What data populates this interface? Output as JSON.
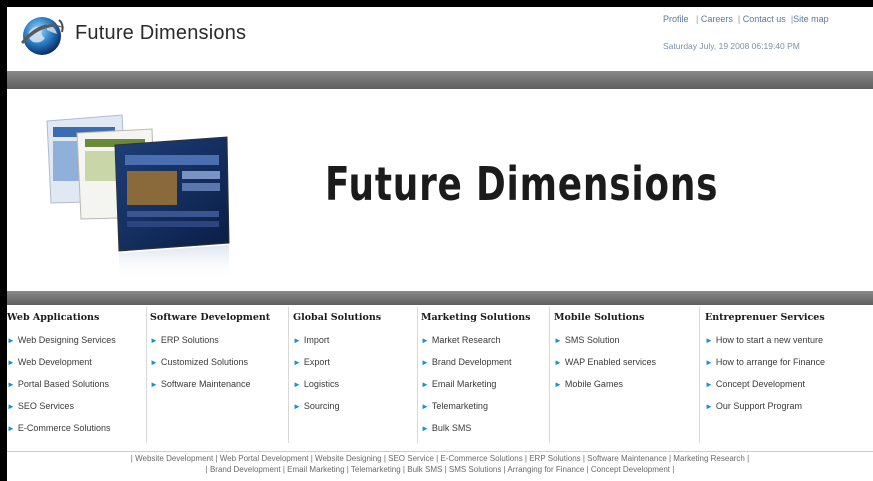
{
  "header": {
    "brand": "Future Dimensions",
    "links": [
      "Profile",
      "Careers",
      "Contact us",
      "Site map"
    ],
    "datetime": "Saturday July, 19 2008 06:19:40 PM"
  },
  "banner": {
    "title": "Future Dimensions"
  },
  "menus": [
    {
      "heading": "Web Applications",
      "items": [
        "Web Designing Services",
        "Web Development",
        "Portal Based Solutions",
        "SEO Services",
        "E-Commerce Solutions"
      ]
    },
    {
      "heading": "Software Development",
      "items": [
        "ERP Solutions",
        "Customized Solutions",
        "Software Maintenance"
      ]
    },
    {
      "heading": "Global Solutions",
      "items": [
        "Import",
        "Export",
        "Logistics",
        "Sourcing"
      ]
    },
    {
      "heading": "Marketing Solutions",
      "items": [
        "Market Research",
        "Brand Development",
        "Email Marketing",
        "Telemarketing",
        "Bulk SMS"
      ]
    },
    {
      "heading": "Mobile Solutions",
      "items": [
        "SMS Solution",
        "WAP Enabled services",
        "Mobile Games"
      ]
    },
    {
      "heading": "Entreprenuer Services",
      "items": [
        "How to start a new venture",
        "How to arrange for Finance",
        "Concept Development",
        "Our Support Program"
      ]
    }
  ],
  "footer": {
    "line1": "| Website Development | Web Portal Development | Website Designing | SEO Service | E-Commerce Solutions | ERP Solutions | Software Maintenance | Marketing Research |",
    "line2": "| Brand Development | Email Marketing | Telemarketing | Bulk SMS | SMS Solutions | Arranging for Finance | Concept Development |"
  },
  "colors": {
    "accent": "#1c8fd0",
    "bar": "#6e6e6e",
    "link": "#5a78a0"
  }
}
